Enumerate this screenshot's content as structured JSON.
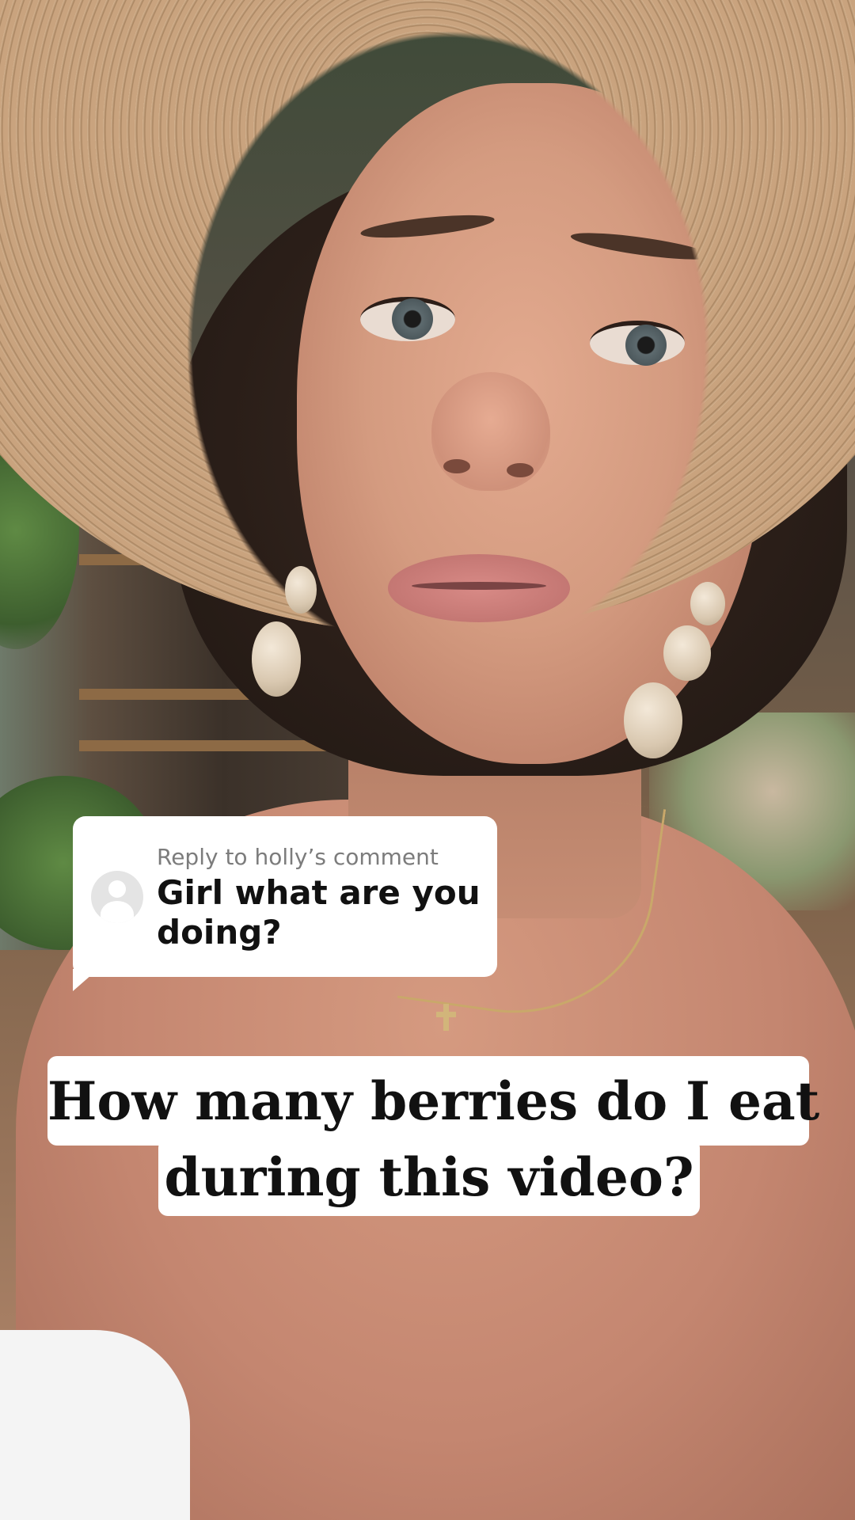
{
  "reply_sticker": {
    "header": "Reply to holly’s comment",
    "comment": "Girl what are you doing?",
    "avatar_icon": "default-avatar-icon"
  },
  "caption": {
    "line1": "How many berries do I eat",
    "line2": "during this video?"
  },
  "colors": {
    "sticker_bg": "#ffffff",
    "sticker_header": "#7c7c7c",
    "text_primary": "#111111"
  }
}
